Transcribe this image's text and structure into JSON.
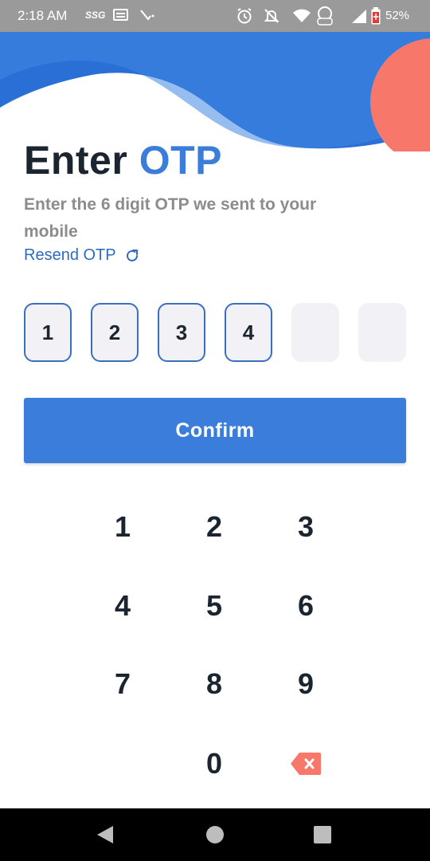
{
  "status_bar": {
    "time": "2:18 AM",
    "carrier": "SSG",
    "battery": "52%"
  },
  "page": {
    "title_part1": "Enter",
    "title_part2": "OTP",
    "subtitle": "Enter the 6 digit OTP we sent to your mobile",
    "resend_label": "Resend OTP"
  },
  "otp": {
    "digits": [
      "1",
      "2",
      "3",
      "4",
      "",
      ""
    ]
  },
  "confirm_label": "Confirm",
  "keypad": {
    "keys": [
      "1",
      "2",
      "3",
      "4",
      "5",
      "6",
      "7",
      "8",
      "9",
      "0"
    ]
  },
  "colors": {
    "accent": "#3a7ddb",
    "wave_dark": "#2a6fd6",
    "coral": "#f7776b",
    "key_text": "#1b2530"
  },
  "icons": {
    "resend": "refresh-icon",
    "backspace": "backspace-icon",
    "nav": [
      "back-icon",
      "home-icon",
      "recents-icon"
    ]
  }
}
